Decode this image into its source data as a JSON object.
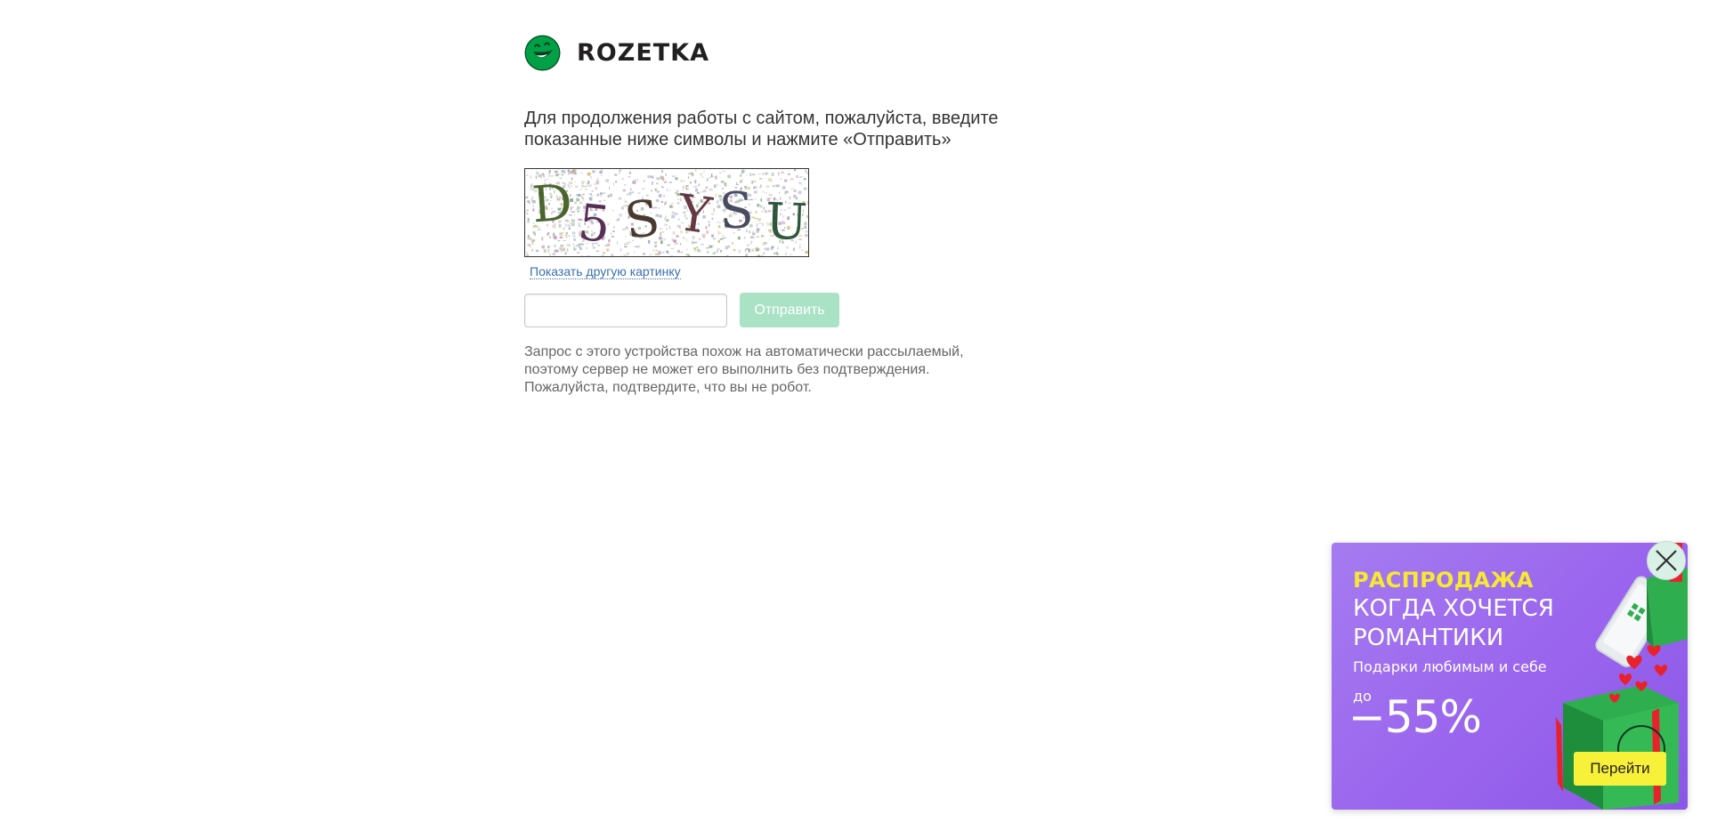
{
  "logo": {
    "text": "ROZETKA",
    "icon": "rozetka-smile-logo-icon",
    "color": "#00a046"
  },
  "instruction": "Для продолжения работы с сайтом, пожалуйста, введите показанные ниже символы и нажмите «Отправить»",
  "captcha": {
    "image_text": "D5SYSU",
    "reload_label": "Показать другую картинку"
  },
  "form": {
    "input_value": "",
    "submit_label": "Отправить",
    "submit_color": "#a9e2c4"
  },
  "note": {
    "line1": "Запрос с этого устройства похож на автоматически рассылаемый,",
    "line2": "поэтому сервер не может его выполнить без подтверждения.",
    "line3": "Пожалуйста, подтвердите, что вы не робот."
  },
  "promo": {
    "sale": "РАСПРОДАЖА",
    "title_line1": "КОГДА ХОЧЕТСЯ",
    "title_line2": "РОМАНТИКИ",
    "subtitle": "Подарки любимым и себе",
    "prefix": "до",
    "discount": "−55%",
    "button_label": "Перейти",
    "background": "#9a64ee",
    "accent": "#f7e833",
    "close_icon": "close-x-icon"
  }
}
